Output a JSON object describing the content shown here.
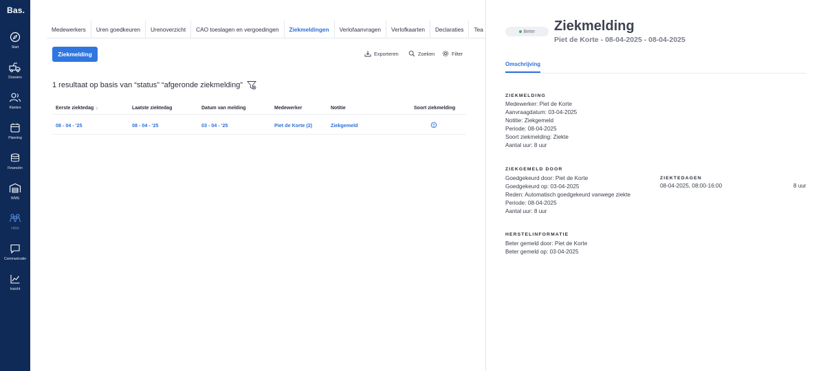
{
  "app": {
    "logo": "Bas."
  },
  "sidebar": {
    "items": [
      {
        "label": "Start",
        "icon": "compass-icon"
      },
      {
        "label": "Dossiers",
        "icon": "truck-icon"
      },
      {
        "label": "Klanten",
        "icon": "users-icon"
      },
      {
        "label": "Planning",
        "icon": "calendar-icon"
      },
      {
        "label": "Financiën",
        "icon": "coins-icon"
      },
      {
        "label": "WMS",
        "icon": "warehouse-icon"
      },
      {
        "label": "HRM",
        "icon": "team-icon",
        "active": true
      },
      {
        "label": "Communicatie",
        "icon": "chat-icon"
      },
      {
        "label": "Inzicht",
        "icon": "chart-icon"
      }
    ]
  },
  "tabs": [
    {
      "label": "Medewerkers"
    },
    {
      "label": "Uren goedkeuren"
    },
    {
      "label": "Urenoverzicht"
    },
    {
      "label": "CAO toeslagen en vergoedingen"
    },
    {
      "label": "Ziekmeldingen",
      "active": true
    },
    {
      "label": "Verlofaanvragen"
    },
    {
      "label": "Verlofkaarten"
    },
    {
      "label": "Declaraties"
    },
    {
      "label": "Tea"
    }
  ],
  "actions": {
    "primary": "Ziekmelding",
    "export": "Exporteren",
    "search": "Zoeken",
    "filter": "Filter"
  },
  "result_text": "1 resultaat op basis van “status” “afgeronde ziekmelding”",
  "table": {
    "headers": {
      "first_day": "Eerste ziektedag",
      "last_day": "Laatste ziektedag",
      "reported": "Datum van melding",
      "employee": "Medewerker",
      "note": "Notitie",
      "type": "Soort ziekmelding"
    },
    "rows": [
      {
        "first_day": "08 - 04 - '25",
        "last_day": "08 - 04 - '25",
        "reported": "03 - 04 - '25",
        "employee": "Piet de Korte (2)",
        "note": "Ziekgemeld",
        "type_icon": "face-icon"
      }
    ]
  },
  "detail": {
    "status": "Beter",
    "title": "Ziekmelding",
    "subtitle": "Piet de Korte - 08-04-2025 - 08-04-2025",
    "tab": "Omschrijving",
    "sections": {
      "ziekmelding": {
        "heading": "ZIEKMELDING",
        "lines": [
          "Medewerker: Piet de Korte",
          "Aanvraagdatum: 03-04-2025",
          "Notitie: Ziekgemeld",
          "Periode: 08-04-2025",
          "Soort ziekmelding: Ziekte",
          "Aantal uur: 8 uur"
        ]
      },
      "ziekgemeld_door": {
        "heading": "ZIEKGEMELD DOOR",
        "lines": [
          "Goedgekeurd door: Piet de Korte",
          "Goedgekeurd op: 03-04-2025",
          "Reden: Automatisch goedgekeurd vanwege ziekte",
          "Periode: 08-04-2025",
          "Aantal uur: 8 uur"
        ]
      },
      "ziektedagen": {
        "heading": "ZIEKTEDAGEN",
        "range": "08-04-2025, 08:00-16:00",
        "hours": "8 uur"
      },
      "herstel": {
        "heading": "HERSTELINFORMATIE",
        "lines": [
          "Beter gemeld door: Piet de Korte",
          "Beter gemeld op: 03-04-2025"
        ]
      }
    }
  }
}
